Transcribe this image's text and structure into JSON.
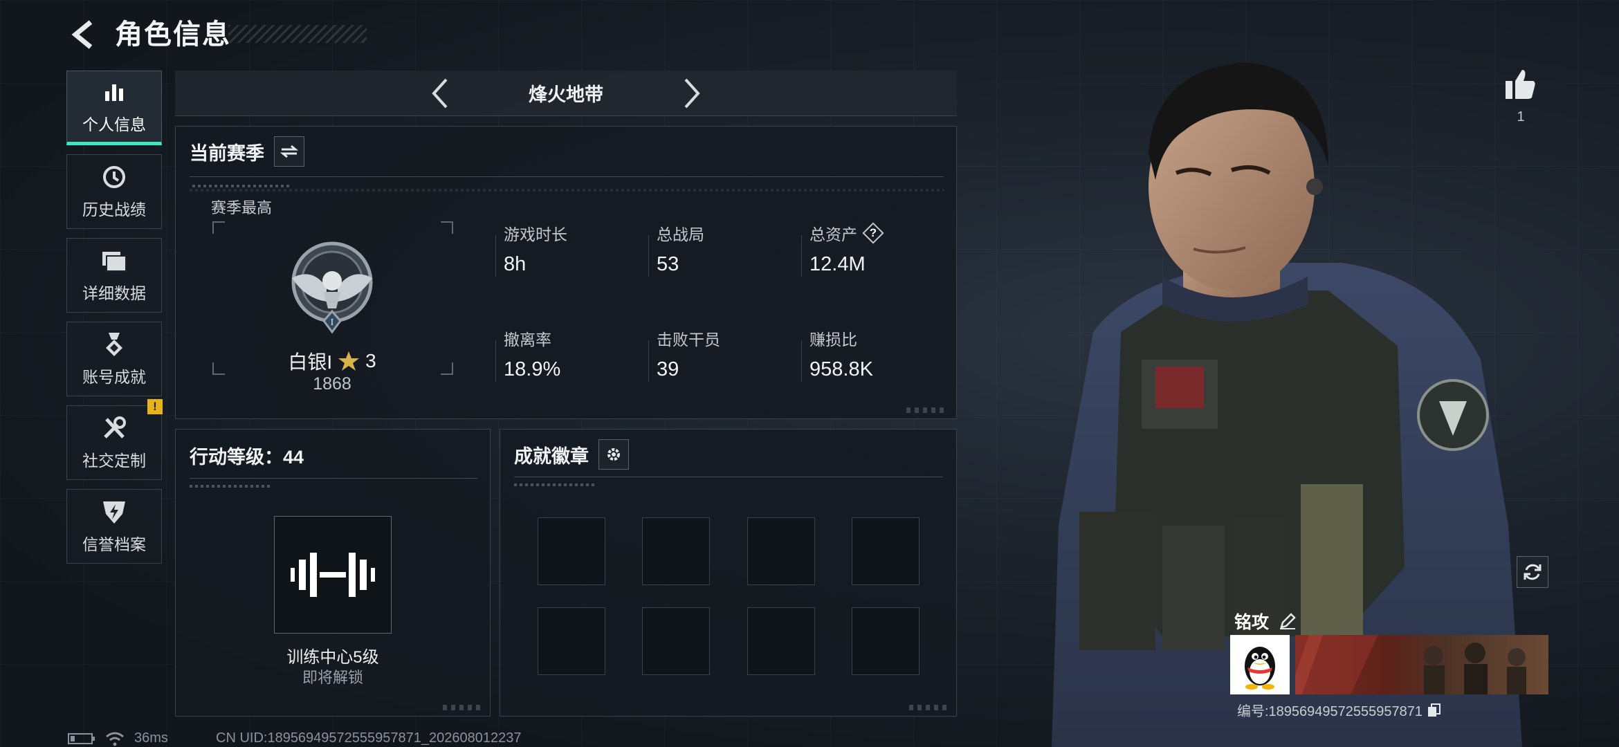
{
  "header": {
    "title": "角色信息"
  },
  "sidebar": {
    "items": [
      {
        "label": "个人信息",
        "icon": "bar-chart-icon",
        "active": true
      },
      {
        "label": "历史战绩",
        "icon": "history-icon"
      },
      {
        "label": "详细数据",
        "icon": "folder-icon"
      },
      {
        "label": "账号成就",
        "icon": "medal-icon"
      },
      {
        "label": "社交定制",
        "icon": "tools-icon",
        "badge": "!"
      },
      {
        "label": "信誉档案",
        "icon": "shield-bolt-icon"
      }
    ]
  },
  "mode": {
    "name": "烽火地带"
  },
  "season": {
    "title": "当前赛季",
    "best_label": "赛季最高",
    "rank_name": "白银I",
    "rank_stars": "3",
    "rank_score": "1868",
    "rank_tier": "I",
    "stats": [
      {
        "label": "游戏时长",
        "value": "8h"
      },
      {
        "label": "总战局",
        "value": "53"
      },
      {
        "label": "总资产",
        "value": "12.4M",
        "help": "?"
      },
      {
        "label": "撤离率",
        "value": "18.9%"
      },
      {
        "label": "击败干员",
        "value": "39"
      },
      {
        "label": "赚损比",
        "value": "958.8K"
      }
    ]
  },
  "action_level": {
    "title": "行动等级：44",
    "training_name": "训练中心5级",
    "training_status": "即将解锁"
  },
  "badges": {
    "title": "成就徽章",
    "slot_count": 8
  },
  "profile": {
    "likes": "1",
    "name": "铭攻",
    "id_text": "编号:18956949572555957871"
  },
  "footer": {
    "ping": "36ms",
    "uid": "CN UID:18956949572555957871_202608012237"
  },
  "colors": {
    "accent": "#3ce8c6",
    "alert": "#e8b317",
    "panel": "#141a21"
  }
}
